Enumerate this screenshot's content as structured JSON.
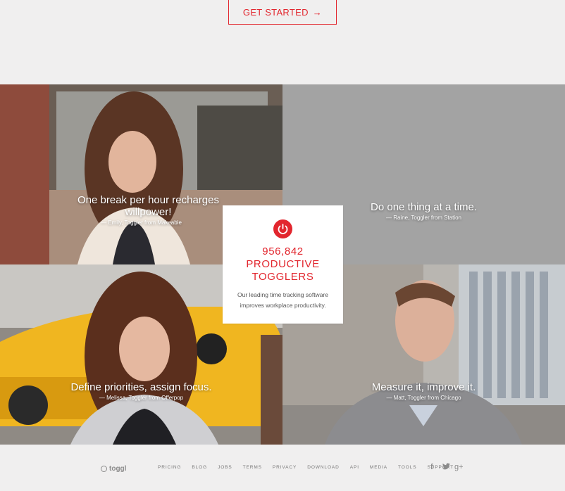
{
  "cta": {
    "label": "GET STARTED",
    "arrow": "→"
  },
  "tiles": [
    {
      "quote": "One break per hour recharges willpower!",
      "attribution": "— Emily, Toggler from Makeable"
    },
    {
      "quote": "Do one thing at a time.",
      "attribution": "— Raine, Toggler from Station"
    },
    {
      "quote": "Define priorities, assign focus.",
      "attribution": "— Melissa, Toggler from Offerpop"
    },
    {
      "quote": "Measure it, improve it.",
      "attribution": "— Matt, Toggler from Chicago"
    }
  ],
  "card": {
    "icon": "power-icon",
    "count": "956,842",
    "line1": "PRODUCTIVE",
    "line2": "TOGGLERS",
    "description_line1": "Our leading time tracking software",
    "description_line2": "improves workplace productivity."
  },
  "footer": {
    "logo": "toggl",
    "nav": [
      "PRICING",
      "BLOG",
      "JOBS",
      "TERMS",
      "PRIVACY",
      "DOWNLOAD",
      "API",
      "MEDIA",
      "TOOLS",
      "SUPPORT"
    ],
    "social": [
      "f",
      "twitter",
      "g+"
    ]
  },
  "colors": {
    "accent": "#e2262e",
    "background": "#f0efef",
    "placeholder_tile": "#a3a3a3"
  }
}
